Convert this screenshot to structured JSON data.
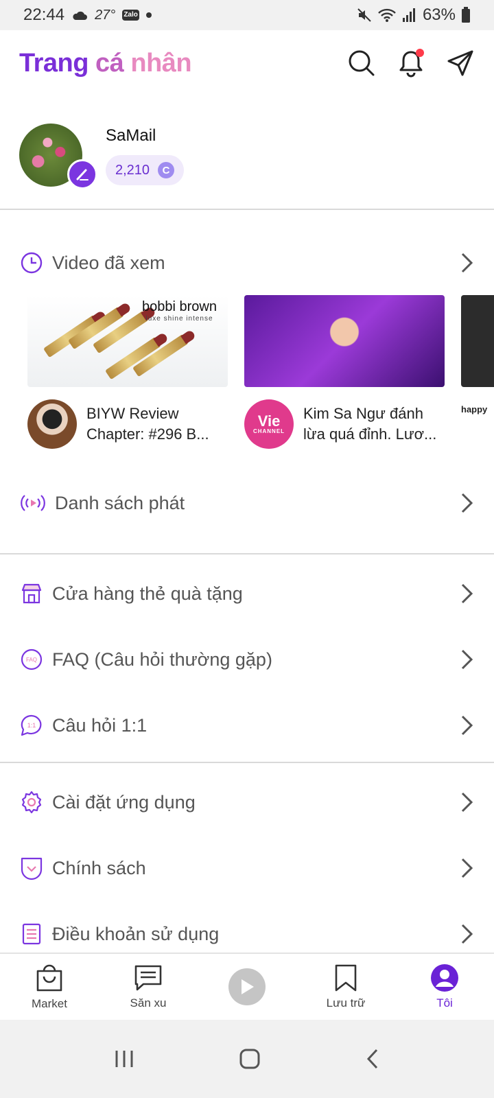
{
  "status_bar": {
    "time": "22:44",
    "temperature": "27°",
    "zalo": "Zalo",
    "battery": "63%"
  },
  "header": {
    "title_part1": "Trang",
    "title_part2": "cá",
    "title_part3": "nhân"
  },
  "profile": {
    "username": "SaMail",
    "coins": "2,210",
    "coin_symbol": "C"
  },
  "watched": {
    "label": "Video đã xem",
    "videos": [
      {
        "title": "BIYW Review Chapter: #296 B...",
        "brand": "bobbi brown",
        "brand_sub": "luxe shine intense"
      },
      {
        "title": "Kim Sa Ngư đánh lừa quá đỉnh. Lươ...",
        "channel": "Vie",
        "channel_sub": "CHANNEL"
      },
      {
        "title": "happy"
      }
    ]
  },
  "menu": {
    "playlist": "Danh sách phát",
    "gift_store": "Cửa hàng thẻ quà tặng",
    "faq": "FAQ (Câu hỏi thường gặp)",
    "qa": "Câu hỏi 1:1",
    "settings": "Cài đặt ứng dụng",
    "policy": "Chính sách",
    "terms": "Điều khoản sử dụng"
  },
  "bottom_nav": {
    "market": "Market",
    "san_xu": "Săn xu",
    "luu_tru": "Lưu trữ",
    "toi": "Tôi"
  },
  "colors": {
    "accent": "#7b35e0",
    "active": "#6a22d6",
    "notification": "#ff3b4a"
  }
}
